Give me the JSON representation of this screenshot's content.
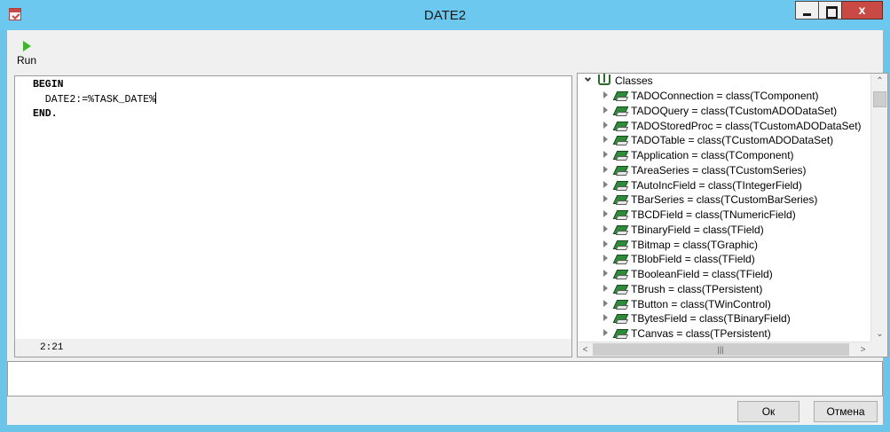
{
  "window": {
    "title": "DATE2"
  },
  "titlebar_buttons": {
    "close_glyph": "x"
  },
  "toolbar": {
    "run_label": "Run"
  },
  "editor": {
    "lines": [
      "BEGIN",
      "  DATE2:=%TASK_DATE%",
      "END."
    ],
    "cursor_position": "2:21"
  },
  "tree": {
    "root_label": "Classes",
    "items": [
      "TADOConnection = class(TComponent)",
      "TADOQuery = class(TCustomADODataSet)",
      "TADOStoredProc = class(TCustomADODataSet)",
      "TADOTable = class(TCustomADODataSet)",
      "TApplication = class(TComponent)",
      "TAreaSeries = class(TCustomSeries)",
      "TAutoIncField = class(TIntegerField)",
      "TBarSeries = class(TCustomBarSeries)",
      "TBCDField = class(TNumericField)",
      "TBinaryField = class(TField)",
      "TBitmap = class(TGraphic)",
      "TBlobField = class(TField)",
      "TBooleanField = class(TField)",
      "TBrush = class(TPersistent)",
      "TButton = class(TWinControl)",
      "TBytesField = class(TBinaryField)",
      "TCanvas = class(TPersistent)"
    ]
  },
  "buttons": {
    "ok": "Ок",
    "cancel": "Отмена"
  },
  "colors": {
    "titlebar": "#6cc8ee",
    "close_button": "#c94a45",
    "run_icon": "#3fb52e",
    "class_icon": "#2e8b3a"
  }
}
